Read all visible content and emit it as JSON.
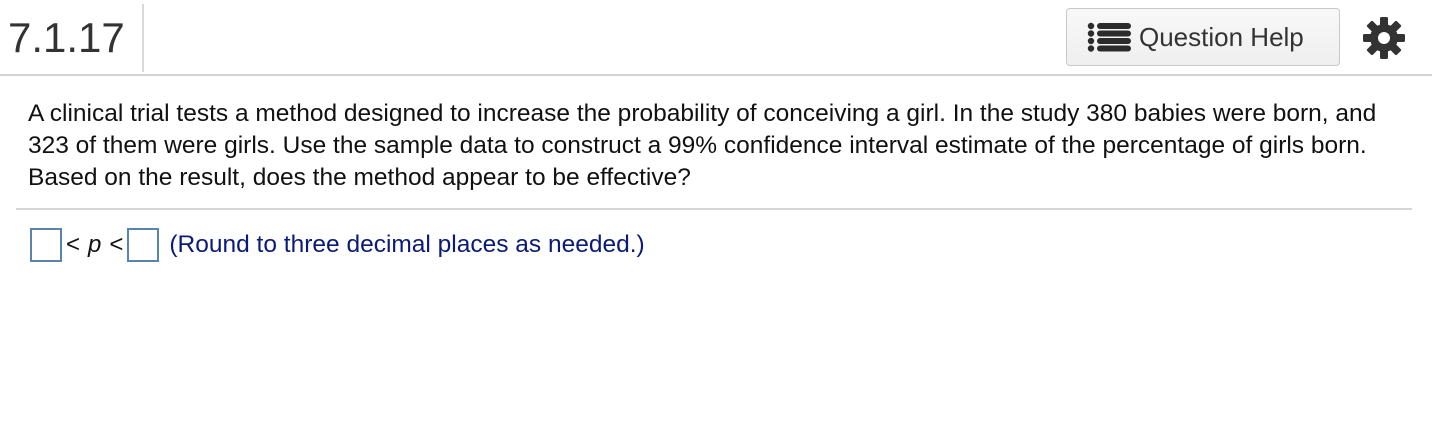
{
  "header": {
    "question_number": "7.1.17",
    "help_label": "Question Help",
    "help_icon": "list-icon",
    "settings_icon": "gear-icon"
  },
  "question": {
    "text": "A clinical trial tests a method designed to increase the probability of conceiving a girl. In the study 380 babies were born, and 323 of them were girls. Use the sample data to construct a 99% confidence interval estimate of the percentage of girls born. Based on the result, does the method appear to be effective?"
  },
  "answer": {
    "lower_value": "",
    "less_than_1": "<",
    "variable": "p",
    "less_than_2": "<",
    "upper_value": "",
    "hint": "(Round to three decimal places as needed.)"
  },
  "colors": {
    "hint_text": "#0a1a78",
    "input_border": "#5a84b0",
    "help_icon": "#2c2c2c"
  }
}
